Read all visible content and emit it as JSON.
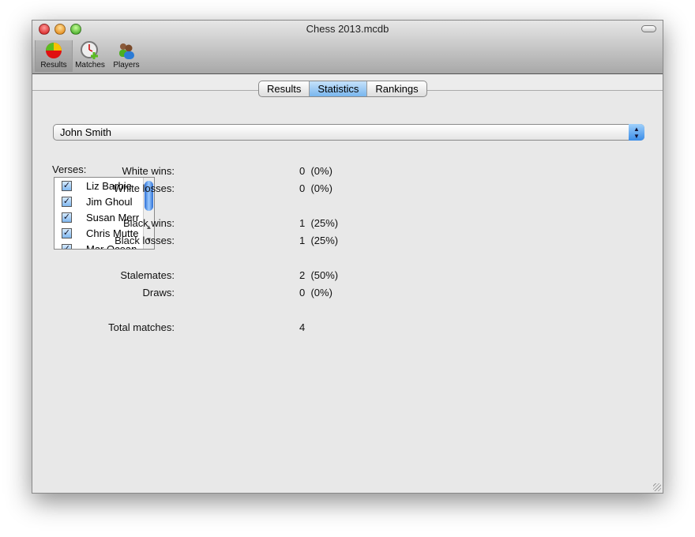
{
  "window": {
    "title": "Chess 2013.mcdb"
  },
  "toolbar": {
    "items": [
      {
        "label": "Results",
        "icon": "pie-chart-icon"
      },
      {
        "label": "Matches",
        "icon": "clock-add-icon"
      },
      {
        "label": "Players",
        "icon": "users-icon"
      }
    ]
  },
  "tabs": {
    "items": [
      "Results",
      "Statistics",
      "Rankings"
    ],
    "selected": "Statistics"
  },
  "player_select": {
    "value": "John Smith"
  },
  "verses": {
    "label": "Verses:",
    "items": [
      {
        "name": "Liz Barbie",
        "checked": true
      },
      {
        "name": "Jim Ghoul",
        "checked": true
      },
      {
        "name": "Susan Merr",
        "checked": true
      },
      {
        "name": "Chris Mutte",
        "checked": true
      },
      {
        "name": "Mar Ocean",
        "checked": true
      }
    ]
  },
  "stats": [
    {
      "label": "White wins:",
      "value": "0  (0%)"
    },
    {
      "label": "White losses:",
      "value": "0  (0%)"
    },
    {
      "label": "Black wins:",
      "value": "1  (25%)"
    },
    {
      "label": "Black losses:",
      "value": "1  (25%)"
    },
    {
      "label": "Stalemates:",
      "value": "2  (50%)"
    },
    {
      "label": "Draws:",
      "value": "0  (0%)"
    },
    {
      "label": "Total matches:",
      "value": "4"
    }
  ]
}
